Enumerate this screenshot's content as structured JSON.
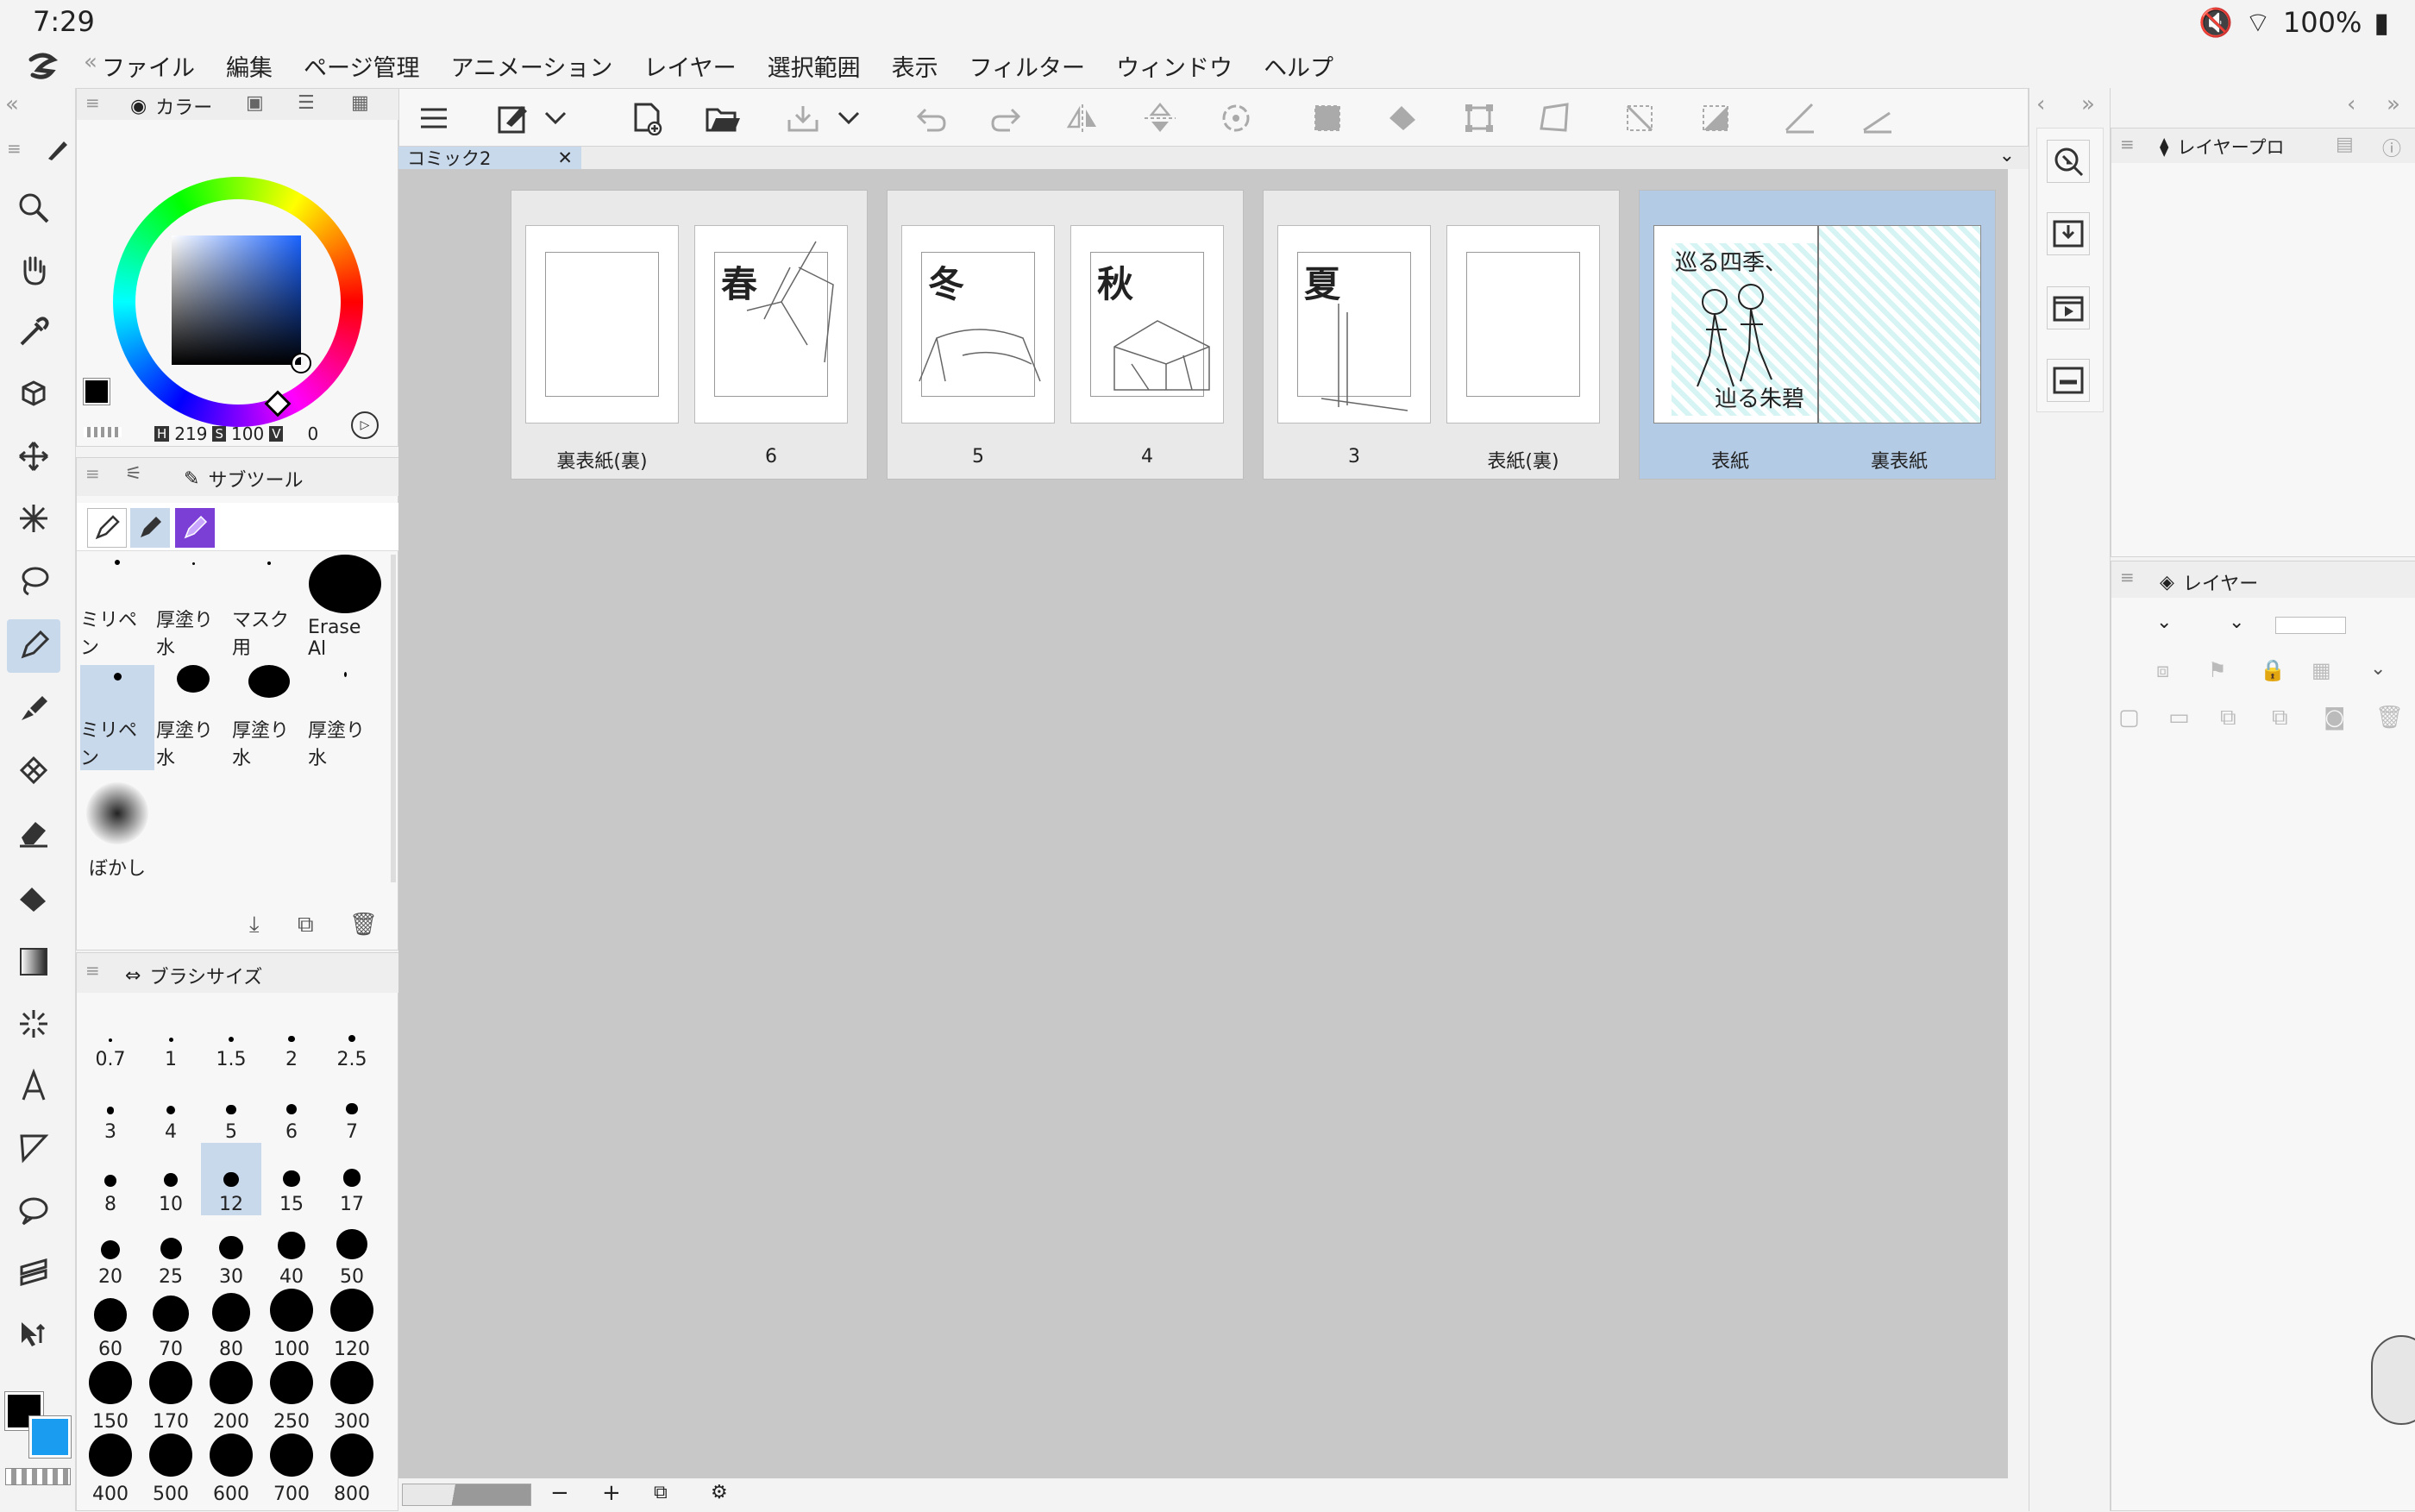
{
  "status": {
    "time": "7:29",
    "battery": "100%"
  },
  "menu": [
    "ファイル",
    "編集",
    "ページ管理",
    "アニメーション",
    "レイヤー",
    "選択範囲",
    "表示",
    "フィルター",
    "ウィンドウ",
    "ヘルプ"
  ],
  "color_panel": {
    "title": "カラー",
    "hsv": {
      "h": "219",
      "s": "100",
      "v": "0"
    },
    "h_label": "H",
    "s_label": "S",
    "v_label": "V",
    "main_color": "#000000",
    "sub_color": "#1a9cf0"
  },
  "subtool_panel": {
    "title": "サブツール",
    "brushes": [
      {
        "label": "ミリペン"
      },
      {
        "label": "厚塗り水"
      },
      {
        "label": "マスク用"
      },
      {
        "label": "Erase Al"
      },
      {
        "label": "ミリペン"
      },
      {
        "label": "厚塗り水"
      },
      {
        "label": "厚塗り水"
      },
      {
        "label": "厚塗り水"
      },
      {
        "label": "ぼかし"
      }
    ]
  },
  "brushsize_panel": {
    "title": "ブラシサイズ",
    "sizes": [
      "0.7",
      "1",
      "1.5",
      "2",
      "2.5",
      "3",
      "4",
      "5",
      "6",
      "7",
      "8",
      "10",
      "12",
      "15",
      "17",
      "20",
      "25",
      "30",
      "40",
      "50",
      "60",
      "70",
      "80",
      "100",
      "120",
      "150",
      "170",
      "200",
      "250",
      "300",
      "400",
      "500",
      "600",
      "700",
      "800"
    ],
    "selected": "12"
  },
  "document": {
    "tab": "コミック2"
  },
  "pages": {
    "labels": [
      "裏表紙(裏)",
      "6",
      "5",
      "4",
      "3",
      "表紙(裏)",
      "表紙",
      "裏表紙"
    ],
    "chapter_marks": [
      "春",
      "冬",
      "秋",
      "夏"
    ],
    "cover_title": "巡る四季、",
    "cover_subtitle": "辿る朱碧"
  },
  "layer_property_panel": {
    "title": "レイヤープロ"
  },
  "layer_panel": {
    "title": "レイヤー"
  },
  "zoom_controls": {
    "minus": "−",
    "plus": "+"
  },
  "colors": {
    "accent_selected": "#c9d9ec",
    "selected_spread": "#b3cbe4",
    "canvas_bg": "#c8c8c8"
  }
}
